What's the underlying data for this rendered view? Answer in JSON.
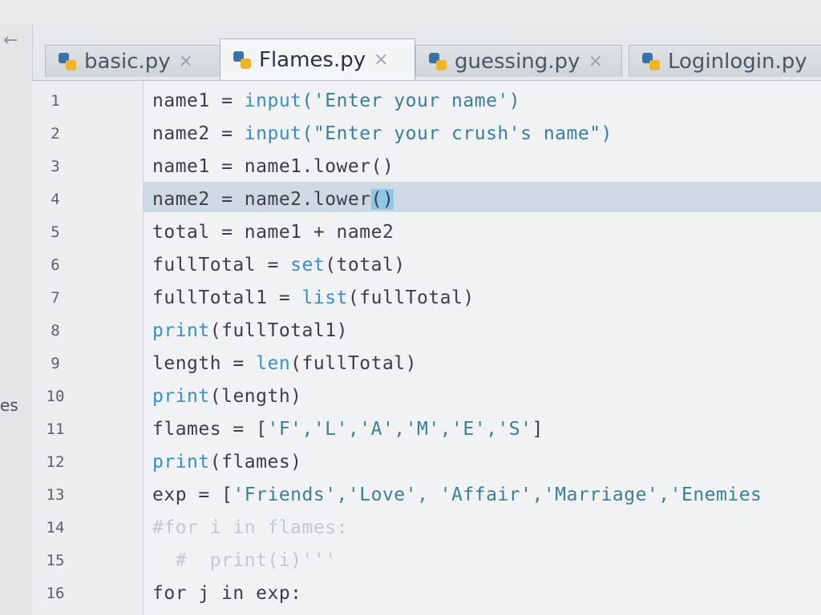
{
  "tabs": [
    {
      "label": "basic.py",
      "close": "×"
    },
    {
      "label": "Flames.py",
      "close": "×"
    },
    {
      "label": "guessing.py",
      "close": "×"
    },
    {
      "label": "Loginlogin.py",
      "close": "×"
    }
  ],
  "sidebar": {
    "back_glyph": "←",
    "partial_text": "es"
  },
  "line_numbers": [
    "1",
    "2",
    "3",
    "4",
    "5",
    "6",
    "7",
    "8",
    "9",
    "10",
    "11",
    "12",
    "13",
    "14",
    "15",
    "16"
  ],
  "code": {
    "l1": {
      "a": "name1 = ",
      "b": "input",
      "c": "('Enter your name')"
    },
    "l2": {
      "a": "name2 = ",
      "b": "input",
      "c": "(\"Enter your crush's name\")"
    },
    "l3": {
      "a": "name1 = name1.lower()"
    },
    "l4": {
      "a": "name2 = name2.lower",
      "b": "()"
    },
    "l5": {
      "a": "total = name1 + name2"
    },
    "l6": {
      "a": "fullTotal = ",
      "b": "set",
      "c": "(total)"
    },
    "l7": {
      "a": "fullTotal1 = ",
      "b": "list",
      "c": "(fullTotal)"
    },
    "l8": {
      "a": "print",
      "b": "(fullTotal1)"
    },
    "l9": {
      "a": "length = ",
      "b": "len",
      "c": "(fullTotal)"
    },
    "l10": {
      "a": "print",
      "b": "(length)"
    },
    "l11": {
      "a": "flames = [",
      "b": "'F','L','A','M','E','S'",
      "c": "]"
    },
    "l12": {
      "a": "print",
      "b": "(flames)"
    },
    "l13": {
      "a": "exp = [",
      "b": "'Friends','Love', 'Affair','Marriage','Enemies"
    },
    "l14": {
      "a": "#for i in flames:"
    },
    "l15": {
      "a": "  #  print(i)'''"
    },
    "l16": {
      "a": "for j in exp:"
    }
  },
  "colors": {
    "keyword": "#3b8ec9",
    "string": "#3a7e9a",
    "comment": "#c4c8cc",
    "highlight": "#cfd9e4"
  }
}
